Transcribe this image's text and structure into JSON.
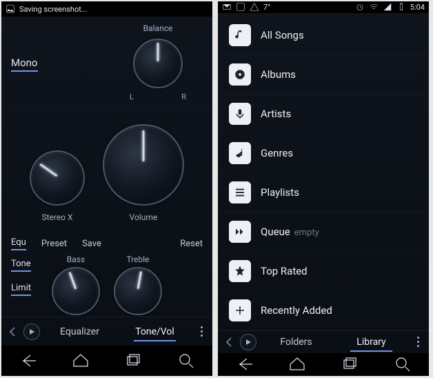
{
  "left": {
    "status": {
      "activity": "Saving screenshot..."
    },
    "balance": {
      "label": "Balance",
      "left": "L",
      "right": "R",
      "mono": "Mono"
    },
    "stereo_x": "Stereo X",
    "volume": "Volume",
    "buttons": {
      "equ": "Equ",
      "preset": "Preset",
      "save": "Save",
      "reset": "Reset"
    },
    "tone_label": "Tone",
    "limit_label": "Limit",
    "bass": "Bass",
    "treble": "Treble",
    "tabs": {
      "equalizer": "Equalizer",
      "tone_vol": "Tone/Vol"
    }
  },
  "right": {
    "status": {
      "temp": "7°",
      "time": "5:04"
    },
    "items": [
      {
        "icon": "note",
        "label": "All Songs"
      },
      {
        "icon": "disc",
        "label": "Albums"
      },
      {
        "icon": "mic",
        "label": "Artists"
      },
      {
        "icon": "guitar",
        "label": "Genres"
      },
      {
        "icon": "list",
        "label": "Playlists"
      },
      {
        "icon": "queue",
        "label": "Queue",
        "sub": "empty"
      },
      {
        "icon": "star",
        "label": "Top Rated"
      },
      {
        "icon": "plus",
        "label": "Recently Added"
      }
    ],
    "tabs": {
      "folders": "Folders",
      "library": "Library"
    }
  }
}
